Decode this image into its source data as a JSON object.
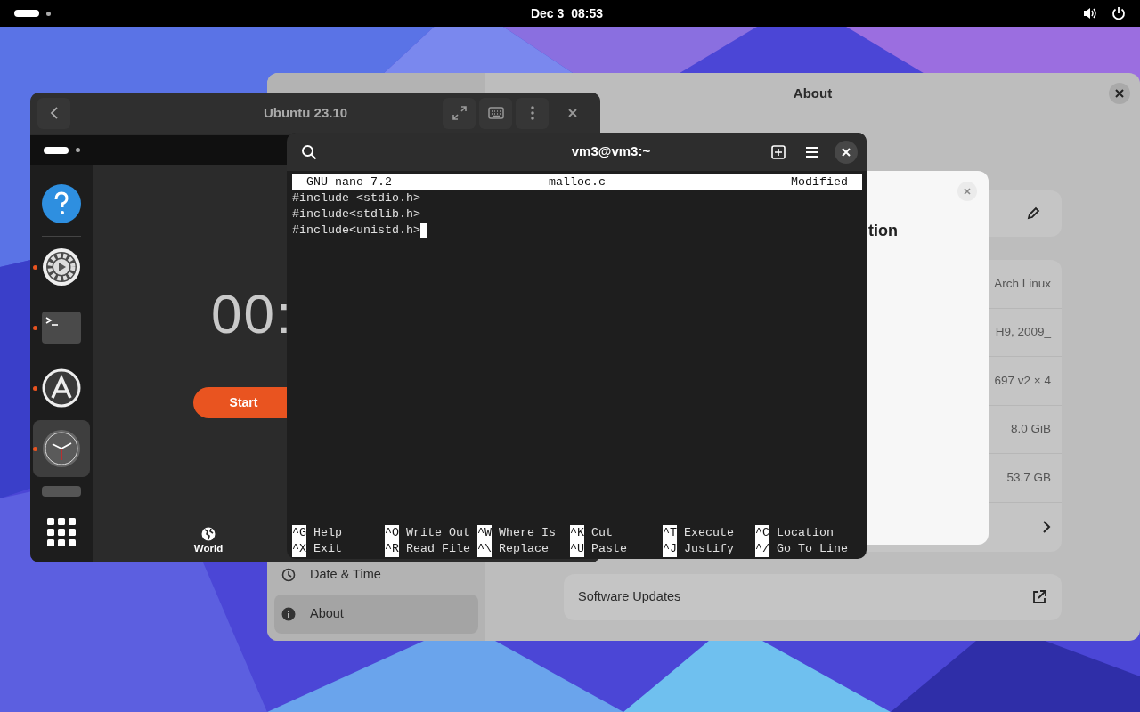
{
  "top_bar": {
    "date": "Dec 3",
    "time": "08:53"
  },
  "settings_window": {
    "page_title": "About",
    "sidebar": [
      {
        "label": "Date & Time",
        "kind": "clock",
        "selected": false
      },
      {
        "label": "About",
        "kind": "info",
        "selected": true
      }
    ],
    "info_rows": [
      {
        "kind": "value",
        "value": "Arch Linux"
      },
      {
        "kind": "value",
        "value": "H9, 2009_"
      },
      {
        "kind": "value",
        "value": "697 v2 × 4"
      },
      {
        "kind": "value",
        "value": "8.0 GiB"
      },
      {
        "kind": "value",
        "value": "53.7 GB"
      },
      {
        "kind": "link"
      }
    ],
    "software_updates": "Software Updates"
  },
  "dialog": {
    "title_fragment": "tion"
  },
  "vm_window": {
    "title": "Ubuntu 23.10",
    "guest": {
      "dock": [
        {
          "kind": "help",
          "running": false,
          "selected": false
        },
        {
          "kind": "settings",
          "running": true,
          "selected": false
        },
        {
          "kind": "terminal",
          "running": true,
          "selected": false
        },
        {
          "kind": "software",
          "running": true,
          "selected": false
        },
        {
          "kind": "clock",
          "running": true,
          "selected": true
        }
      ],
      "clock_display": "00:",
      "start_button": "Start",
      "tab": "World"
    }
  },
  "terminal": {
    "title": "vm3@vm3:~",
    "nano": {
      "version": "GNU nano 7.2",
      "filename": "malloc.c",
      "status": "Modified",
      "lines": [
        "#include <stdio.h>",
        "#include<stdlib.h>",
        "#include<unistd.h>"
      ],
      "shortcuts": [
        {
          "key": "^G",
          "label": "Help"
        },
        {
          "key": "^O",
          "label": "Write Out"
        },
        {
          "key": "^W",
          "label": "Where Is"
        },
        {
          "key": "^K",
          "label": "Cut"
        },
        {
          "key": "^T",
          "label": "Execute"
        },
        {
          "key": "^C",
          "label": "Location"
        },
        {
          "key": "^X",
          "label": "Exit"
        },
        {
          "key": "^R",
          "label": "Read File"
        },
        {
          "key": "^\\",
          "label": "Replace"
        },
        {
          "key": "^U",
          "label": "Paste"
        },
        {
          "key": "^J",
          "label": "Justify"
        },
        {
          "key": "^/",
          "label": "Go To Line"
        }
      ]
    }
  }
}
